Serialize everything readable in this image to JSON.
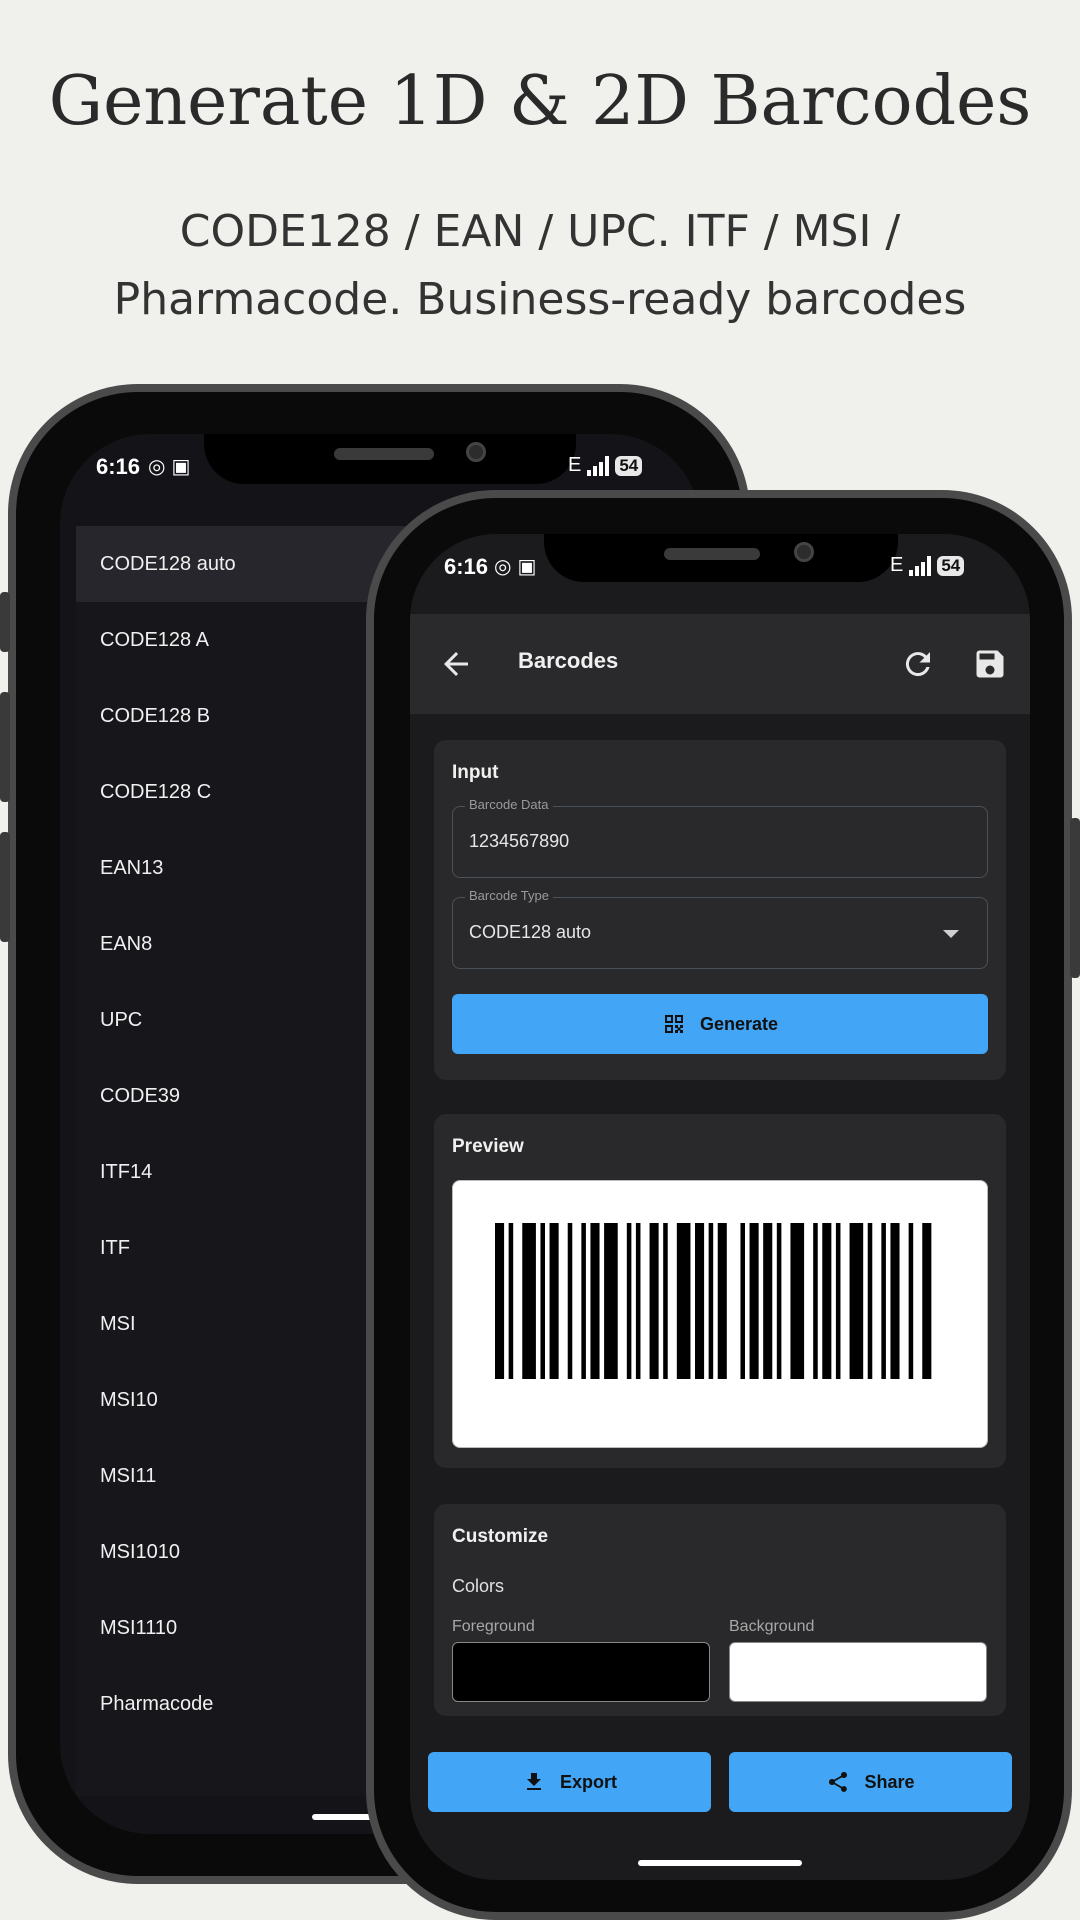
{
  "promo": {
    "title": "Generate 1D & 2D Barcodes",
    "subtitle_line1": "CODE128 / EAN / UPC. ITF / MSI /",
    "subtitle_line2": "Pharmacode. Business-ready barcodes"
  },
  "status": {
    "time": "6:16",
    "battery": "54"
  },
  "barcode_types": [
    "CODE128 auto",
    "CODE128 A",
    "CODE128 B",
    "CODE128 C",
    "EAN13",
    "EAN8",
    "UPC",
    "CODE39",
    "ITF14",
    "ITF",
    "MSI",
    "MSI10",
    "MSI11",
    "MSI1010",
    "MSI1110",
    "Pharmacode"
  ],
  "selected_type_index": 0,
  "app": {
    "title": "Barcodes",
    "input_card": {
      "title": "Input",
      "data_label": "Barcode Data",
      "data_value": "1234567890",
      "type_label": "Barcode Type",
      "type_value": "CODE128 auto",
      "generate_label": "Generate"
    },
    "preview_card": {
      "title": "Preview"
    },
    "customize_card": {
      "title": "Customize",
      "colors_label": "Colors",
      "foreground_label": "Foreground",
      "background_label": "Background",
      "foreground_color": "#000000",
      "background_color": "#ffffff"
    },
    "export_label": "Export",
    "share_label": "Share"
  },
  "colors": {
    "accent": "#42a5f5",
    "surface": "#29292b",
    "background": "#1b1b1d"
  }
}
